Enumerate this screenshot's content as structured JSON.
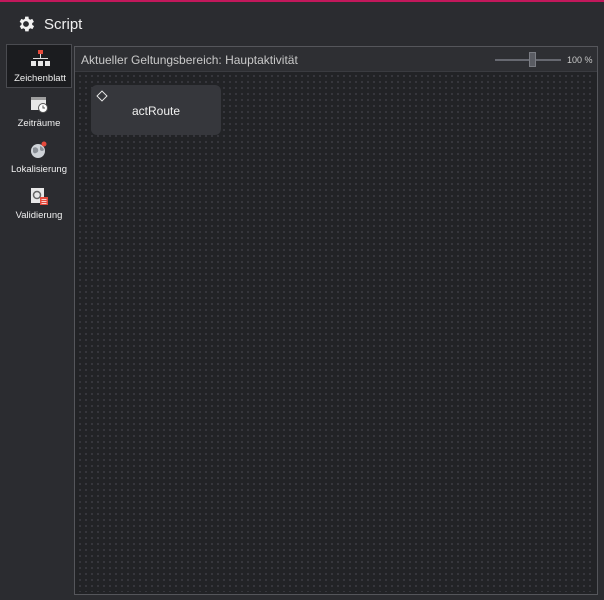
{
  "window": {
    "title": "Script"
  },
  "sidebar": {
    "items": [
      {
        "label": "Zeichenblatt",
        "icon": "hierarchy-icon",
        "active": true
      },
      {
        "label": "Zeiträume",
        "icon": "calendar-clock-icon",
        "active": false
      },
      {
        "label": "Lokalisierung",
        "icon": "globe-icon",
        "active": false
      },
      {
        "label": "Validierung",
        "icon": "validation-icon",
        "active": false
      }
    ]
  },
  "canvas": {
    "scope_label": "Aktueller Geltungsbereich:  Hauptaktivität",
    "zoom": {
      "value": 100,
      "label": "100 %"
    },
    "nodes": [
      {
        "label": "actRoute"
      }
    ]
  },
  "colors": {
    "accent": "#c2185b",
    "background": "#2b2c30",
    "canvas": "#222326",
    "node": "#36373c"
  }
}
